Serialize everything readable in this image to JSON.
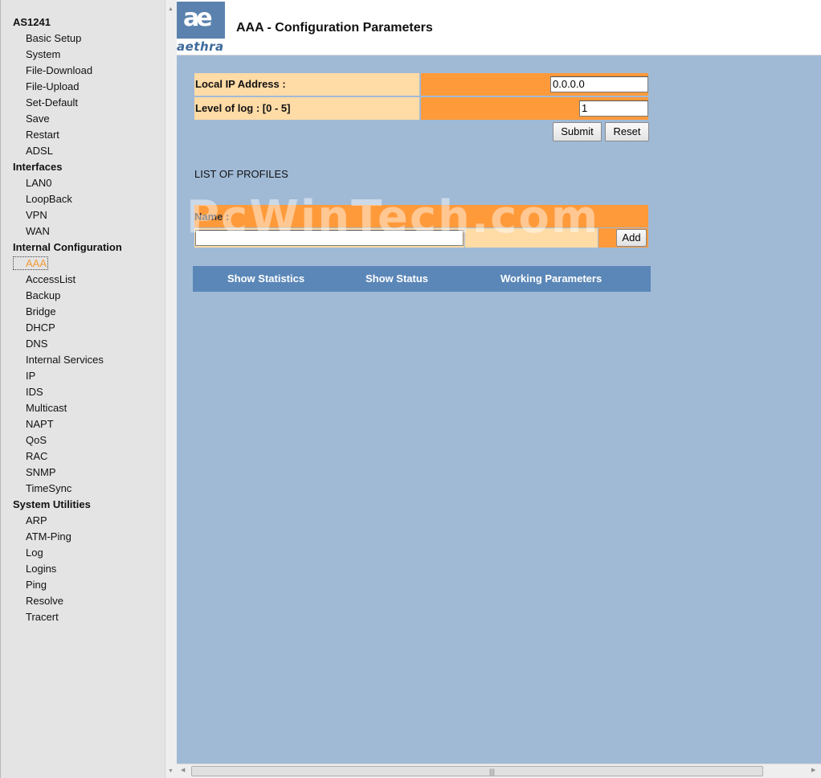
{
  "nav": {
    "sections": [
      {
        "title": "AS1241",
        "items": [
          "Basic Setup",
          "System",
          "File-Download",
          "File-Upload",
          "Set-Default",
          "Save",
          "Restart",
          "ADSL"
        ]
      },
      {
        "title": "Interfaces",
        "items": [
          "LAN0",
          "LoopBack",
          "VPN",
          "WAN"
        ]
      },
      {
        "title": "Internal Configuration",
        "items": [
          "AAA",
          "AccessList",
          "Backup",
          "Bridge",
          "DHCP",
          "DNS",
          "Internal Services",
          "IP",
          "IDS",
          "Multicast",
          "NAPT",
          "QoS",
          "RAC",
          "SNMP",
          "TimeSync"
        ]
      },
      {
        "title": "System Utilities",
        "items": [
          "ARP",
          "ATM-Ping",
          "Log",
          "Logins",
          "Ping",
          "Resolve",
          "Tracert"
        ]
      }
    ],
    "active_item": "AAA"
  },
  "header": {
    "logo_mark": "ae",
    "logo_text": "aethra",
    "title": "AAA - Configuration Parameters"
  },
  "form": {
    "local_ip_label": "Local IP Address :",
    "local_ip_value": "0.0.0.0",
    "log_level_label": "Level of log : [0 - 5]",
    "log_level_value": "1",
    "submit_label": "Submit",
    "reset_label": "Reset"
  },
  "profiles": {
    "title": "LIST OF PROFILES",
    "name_label": "Name :",
    "name_value": "",
    "add_label": "Add"
  },
  "watermark": "PcWinTech.com",
  "tabs": [
    "Show Statistics",
    "Show Status",
    "Working Parameters"
  ],
  "colors": {
    "nav_bg": "#e4e4e4",
    "main_bg": "#a0bad6",
    "label_cell": "#ffdba6",
    "value_cell": "#ff9a3a",
    "tab_bar": "#5b87b8",
    "active_link": "#f29a3a"
  }
}
